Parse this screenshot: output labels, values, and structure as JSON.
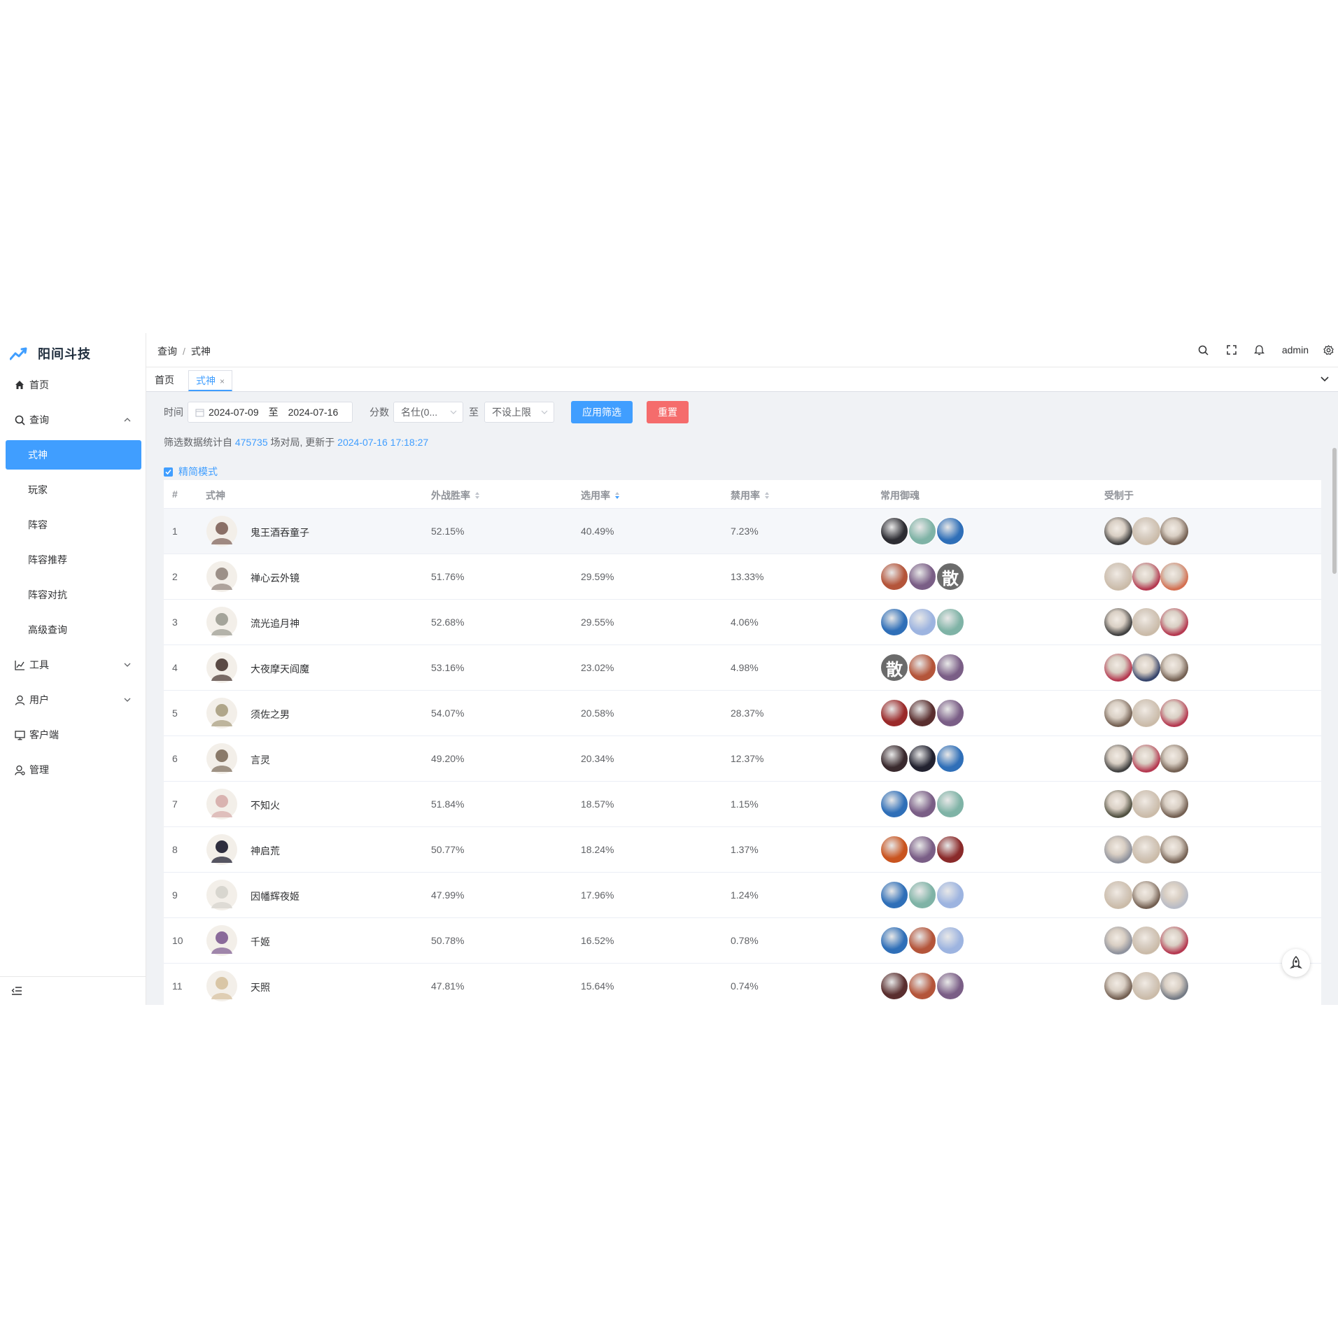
{
  "app": {
    "title": "阳间斗技",
    "brand_color": "#409eff"
  },
  "sidebar": {
    "items": [
      {
        "label": "首页",
        "icon": "home-icon"
      },
      {
        "label": "查询",
        "icon": "search-icon",
        "expanded": true
      },
      {
        "label": "工具",
        "icon": "chart-icon"
      },
      {
        "label": "用户",
        "icon": "user-icon"
      },
      {
        "label": "客户端",
        "icon": "monitor-icon"
      },
      {
        "label": "管理",
        "icon": "admin-icon"
      }
    ],
    "sub_items": [
      {
        "label": "式神",
        "active": true
      },
      {
        "label": "玩家"
      },
      {
        "label": "阵容"
      },
      {
        "label": "阵容推荐"
      },
      {
        "label": "阵容对抗"
      },
      {
        "label": "高级查询"
      }
    ]
  },
  "header": {
    "breadcrumb": [
      "查询",
      "式神"
    ],
    "separator": "/",
    "user": "admin"
  },
  "tabs": [
    {
      "label": "首页"
    },
    {
      "label": "式神",
      "active": true,
      "close": "×"
    }
  ],
  "filters": {
    "time_label": "时间",
    "date_start": "2024-07-09",
    "date_to": "至",
    "date_end": "2024-07-16",
    "score_label": "分数",
    "score_min": "名仕(0...",
    "score_to": "至",
    "score_max": "不设上限",
    "apply_label": "应用筛选",
    "reset_label": "重置"
  },
  "stats": {
    "prefix": "筛选数据统计自",
    "games": "475735",
    "middle": "场对局, 更新于",
    "updated": "2024-07-16 17:18:27"
  },
  "simple_mode": {
    "label": "精简模式",
    "checked": true
  },
  "table": {
    "headers": {
      "rank": "#",
      "name": "式神",
      "win": "外战胜率",
      "pick": "选用率",
      "ban": "禁用率",
      "souls": "常用御魂",
      "counters": "受制于"
    },
    "rows": [
      {
        "rank": "1",
        "name": "鬼王酒吞童子",
        "win": "52.15%",
        "pick": "40.49%",
        "ban": "7.23%",
        "avatar": "#8a6f66",
        "souls": [
          "#2d2d33",
          "#7fb3a6",
          "#2f6fb8"
        ],
        "counters": [
          "#3a3a3a",
          "#c9b9a6",
          "#6e5a4c"
        ]
      },
      {
        "rank": "2",
        "name": "禅心云外镜",
        "win": "51.76%",
        "pick": "29.59%",
        "ban": "13.33%",
        "avatar": "#9c9088",
        "souls": [
          "#b4553a",
          "#7a5e86",
          "散"
        ],
        "counters": [
          "#c9b9a6",
          "#b3314a",
          "#d36a4a"
        ]
      },
      {
        "rank": "3",
        "name": "流光追月神",
        "win": "52.68%",
        "pick": "29.55%",
        "ban": "4.06%",
        "avatar": "#a4a49a",
        "souls": [
          "#2f6fb8",
          "#9db4e0",
          "#7fb3a6"
        ],
        "counters": [
          "#3a3a3a",
          "#c9b9a6",
          "#b3314a"
        ]
      },
      {
        "rank": "4",
        "name": "大夜摩天阎魔",
        "win": "53.16%",
        "pick": "23.02%",
        "ban": "4.98%",
        "avatar": "#5a4a45",
        "souls": [
          "散",
          "#b4553a",
          "#7a5e86"
        ],
        "counters": [
          "#b3314a",
          "#2e3d66",
          "#6e5a4c"
        ]
      },
      {
        "rank": "5",
        "name": "须佐之男",
        "win": "54.07%",
        "pick": "20.58%",
        "ban": "28.37%",
        "avatar": "#b0a68a",
        "souls": [
          "#9a2a2a",
          "#5a2f2f",
          "#7a5e86"
        ],
        "counters": [
          "#6e5a4c",
          "#c9b9a6",
          "#b3314a"
        ]
      },
      {
        "rank": "6",
        "name": "言灵",
        "win": "49.20%",
        "pick": "20.34%",
        "ban": "12.37%",
        "avatar": "#8a7a6a",
        "souls": [
          "#3a2a2e",
          "#222230",
          "#2f6fb8"
        ],
        "counters": [
          "#3a3a3a",
          "#b3314a",
          "#6e5a4c"
        ]
      },
      {
        "rank": "7",
        "name": "不知火",
        "win": "51.84%",
        "pick": "18.57%",
        "ban": "1.15%",
        "avatar": "#d9b3b0",
        "souls": [
          "#2f6fb8",
          "#7a5e86",
          "#7fb3a6"
        ],
        "counters": [
          "#4a4a3a",
          "#c9b9a6",
          "#6e5a4c"
        ]
      },
      {
        "rank": "8",
        "name": "神启荒",
        "win": "50.77%",
        "pick": "18.24%",
        "ban": "1.37%",
        "avatar": "#2e2e3e",
        "souls": [
          "#c9541f",
          "#7a5e86",
          "#8a2a2a"
        ],
        "counters": [
          "#8a8e9a",
          "#c9b9a6",
          "#6e5a4c"
        ]
      },
      {
        "rank": "9",
        "name": "因幡辉夜姬",
        "win": "47.99%",
        "pick": "17.96%",
        "ban": "1.24%",
        "avatar": "#d8d6cf",
        "souls": [
          "#2f6fb8",
          "#7fb3a6",
          "#9db4e0"
        ],
        "counters": [
          "#c9b9a6",
          "#6e5a4c",
          "#b6bac6"
        ]
      },
      {
        "rank": "10",
        "name": "千姬",
        "win": "50.78%",
        "pick": "16.52%",
        "ban": "0.78%",
        "avatar": "#8a6a9a",
        "souls": [
          "#2f6fb8",
          "#b4553a",
          "#9db4e0"
        ],
        "counters": [
          "#8a8e9a",
          "#c9b9a6",
          "#b3314a"
        ]
      },
      {
        "rank": "11",
        "name": "天照",
        "win": "47.81%",
        "pick": "15.64%",
        "ban": "0.74%",
        "avatar": "#d9c6a6",
        "souls": [
          "#5a2f2f",
          "#b4553a",
          "#7a5e86"
        ],
        "counters": [
          "#6e5a4c",
          "#c9b9a6",
          "#6e7580"
        ]
      }
    ]
  }
}
